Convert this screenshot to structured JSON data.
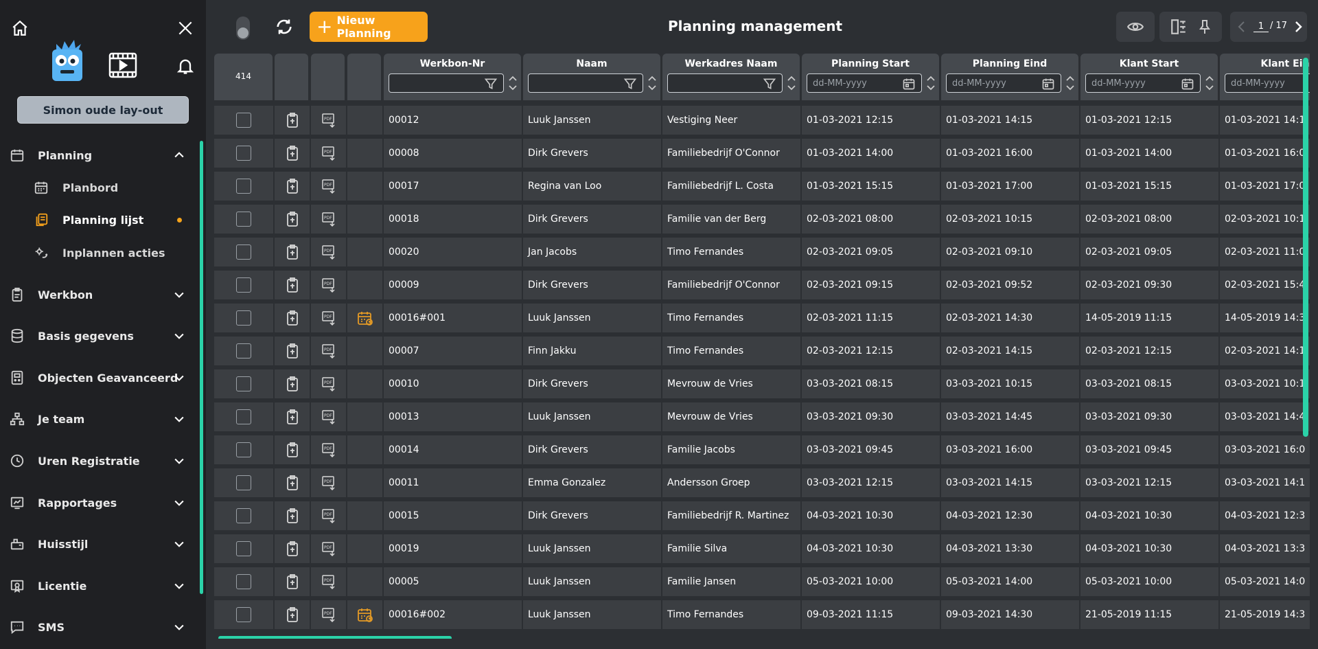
{
  "app": {
    "title": "Planning management"
  },
  "sidebar": {
    "layout_button": "Simon oude lay-out",
    "items": [
      {
        "name": "planning",
        "label": "Planning",
        "icon": "calendar-icon",
        "expanded": true,
        "children": [
          {
            "name": "planbord",
            "label": "Planbord",
            "icon": "calendar-grid-icon"
          },
          {
            "name": "planning-lijst",
            "label": "Planning lijst",
            "icon": "copy-list-icon",
            "active": true
          },
          {
            "name": "inplannen-acties",
            "label": "Inplannen acties",
            "icon": "gear-refresh-icon"
          }
        ]
      },
      {
        "name": "werkbon",
        "label": "Werkbon",
        "icon": "clipboard-icon"
      },
      {
        "name": "basis-gegevens",
        "label": "Basis gegevens",
        "icon": "database-icon"
      },
      {
        "name": "objecten-geavanceerd",
        "label": "Objecten Geavanceerd",
        "icon": "device-icon"
      },
      {
        "name": "je-team",
        "label": "Je team",
        "icon": "team-icon"
      },
      {
        "name": "uren-registratie",
        "label": "Uren Registratie",
        "icon": "clock-icon"
      },
      {
        "name": "rapportages",
        "label": "Rapportages",
        "icon": "report-icon"
      },
      {
        "name": "huisstijl",
        "label": "Huisstijl",
        "icon": "brush-icon"
      },
      {
        "name": "licentie",
        "label": "Licentie",
        "icon": "license-icon"
      },
      {
        "name": "sms",
        "label": "SMS",
        "icon": "chat-icon"
      }
    ]
  },
  "toolbar": {
    "new_label": "Nieuw Planning",
    "page_current": "1",
    "page_total": "/ 17"
  },
  "grid": {
    "count": "414",
    "columns": [
      {
        "label": "Werkbon-Nr",
        "filter_type": "text",
        "placeholder": ""
      },
      {
        "label": "Naam",
        "filter_type": "text",
        "placeholder": ""
      },
      {
        "label": "Werkadres Naam",
        "filter_type": "text",
        "placeholder": ""
      },
      {
        "label": "Planning Start",
        "filter_type": "date",
        "placeholder": "dd-MM-yyyy"
      },
      {
        "label": "Planning Eind",
        "filter_type": "date",
        "placeholder": "dd-MM-yyyy"
      },
      {
        "label": "Klant Start",
        "filter_type": "date",
        "placeholder": "dd-MM-yyyy"
      },
      {
        "label": "Klant Eind",
        "filter_type": "date",
        "placeholder": "dd-MM-yyyy"
      }
    ],
    "rows": [
      {
        "nr": "00012",
        "naam": "Luuk Janssen",
        "werkadres": "Vestiging Neer",
        "pstart": "01-03-2021 12:15",
        "peind": "01-03-2021 14:15",
        "kstart": "01-03-2021 12:15",
        "keind": "01-03-2021 14:1",
        "recurring": false
      },
      {
        "nr": "00008",
        "naam": "Dirk Grevers",
        "werkadres": "Familiebedrijf O'Connor",
        "pstart": "01-03-2021 14:00",
        "peind": "01-03-2021 16:00",
        "kstart": "01-03-2021 14:00",
        "keind": "01-03-2021 16:0",
        "recurring": false
      },
      {
        "nr": "00017",
        "naam": "Regina van Loo",
        "werkadres": "Familiebedrijf L. Costa",
        "pstart": "01-03-2021 15:15",
        "peind": "01-03-2021 17:00",
        "kstart": "01-03-2021 15:15",
        "keind": "01-03-2021 17:0",
        "recurring": false
      },
      {
        "nr": "00018",
        "naam": "Dirk Grevers",
        "werkadres": "Familie van der Berg",
        "pstart": "02-03-2021 08:00",
        "peind": "02-03-2021 10:15",
        "kstart": "02-03-2021 08:00",
        "keind": "02-03-2021 10:1",
        "recurring": false
      },
      {
        "nr": "00020",
        "naam": "Jan Jacobs",
        "werkadres": "Timo Fernandes",
        "pstart": "02-03-2021 09:05",
        "peind": "02-03-2021 09:10",
        "kstart": "02-03-2021 09:05",
        "keind": "02-03-2021 11:0",
        "recurring": false
      },
      {
        "nr": "00009",
        "naam": "Dirk Grevers",
        "werkadres": "Familiebedrijf O'Connor",
        "pstart": "02-03-2021 09:15",
        "peind": "02-03-2021 09:52",
        "kstart": "02-03-2021 09:30",
        "keind": "02-03-2021 15:4",
        "recurring": false
      },
      {
        "nr": "00016#001",
        "naam": "Luuk Janssen",
        "werkadres": "Timo Fernandes",
        "pstart": "02-03-2021 11:15",
        "peind": "02-03-2021 14:30",
        "kstart": "14-05-2019 11:15",
        "keind": "14-05-2019 14:3",
        "recurring": true
      },
      {
        "nr": "00007",
        "naam": "Finn Jakku",
        "werkadres": "Timo Fernandes",
        "pstart": "02-03-2021 12:15",
        "peind": "02-03-2021 14:15",
        "kstart": "02-03-2021 12:15",
        "keind": "02-03-2021 14:1",
        "recurring": false
      },
      {
        "nr": "00010",
        "naam": "Dirk Grevers",
        "werkadres": "Mevrouw de Vries",
        "pstart": "03-03-2021 08:15",
        "peind": "03-03-2021 10:15",
        "kstart": "03-03-2021 08:15",
        "keind": "03-03-2021 10:1",
        "recurring": false
      },
      {
        "nr": "00013",
        "naam": "Luuk Janssen",
        "werkadres": "Mevrouw de Vries",
        "pstart": "03-03-2021 09:30",
        "peind": "03-03-2021 14:45",
        "kstart": "03-03-2021 09:30",
        "keind": "03-03-2021 14:4",
        "recurring": false
      },
      {
        "nr": "00014",
        "naam": "Dirk Grevers",
        "werkadres": "Familie Jacobs",
        "pstart": "03-03-2021 09:45",
        "peind": "03-03-2021 16:00",
        "kstart": "03-03-2021 09:45",
        "keind": "03-03-2021 16:0",
        "recurring": false
      },
      {
        "nr": "00011",
        "naam": "Emma Gonzalez",
        "werkadres": "Andersson Groep",
        "pstart": "03-03-2021 12:15",
        "peind": "03-03-2021 14:15",
        "kstart": "03-03-2021 12:15",
        "keind": "03-03-2021 14:1",
        "recurring": false
      },
      {
        "nr": "00015",
        "naam": "Dirk Grevers",
        "werkadres": "Familiebedrijf R. Martinez",
        "pstart": "04-03-2021 10:30",
        "peind": "04-03-2021 12:30",
        "kstart": "04-03-2021 10:30",
        "keind": "04-03-2021 12:3",
        "recurring": false
      },
      {
        "nr": "00019",
        "naam": "Luuk Janssen",
        "werkadres": "Familie Silva",
        "pstart": "04-03-2021 10:30",
        "peind": "04-03-2021 13:30",
        "kstart": "04-03-2021 10:30",
        "keind": "04-03-2021 13:3",
        "recurring": false
      },
      {
        "nr": "00005",
        "naam": "Luuk Janssen",
        "werkadres": "Familie Jansen",
        "pstart": "05-03-2021 10:00",
        "peind": "05-03-2021 14:00",
        "kstart": "05-03-2021 10:00",
        "keind": "05-03-2021 14:0",
        "recurring": false
      },
      {
        "nr": "00016#002",
        "naam": "Luuk Janssen",
        "werkadres": "Timo Fernandes",
        "pstart": "09-03-2021 11:15",
        "peind": "09-03-2021 14:30",
        "kstart": "21-05-2019 11:15",
        "keind": "21-05-2019 14:3",
        "recurring": true
      }
    ]
  },
  "colors": {
    "accent": "#f7a21b",
    "scroll": "#2bd2a8",
    "active_dot": "#f5a31a"
  }
}
